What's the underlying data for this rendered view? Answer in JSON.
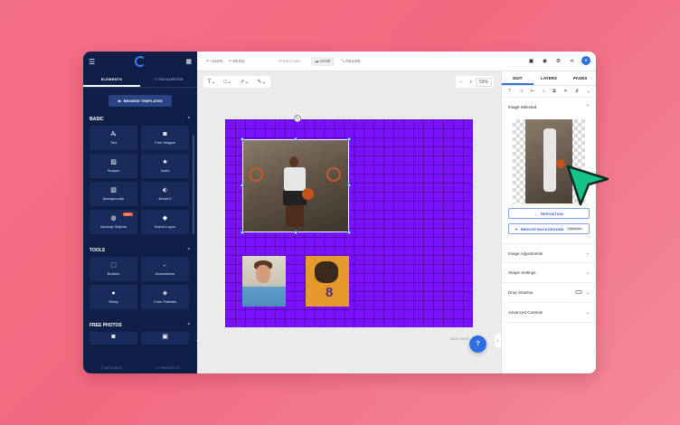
{
  "sidebar": {
    "tabs": [
      {
        "label": "ELEMENTS"
      },
      {
        "label": "FAVOURITES"
      }
    ],
    "browse_button": "BROWSE TEMPLATES",
    "basic_title": "BASIC",
    "basic_items": [
      {
        "label": "Text",
        "icon": "text-icon"
      },
      {
        "label": "Free Images",
        "icon": "camera-icon"
      },
      {
        "label": "Shapes",
        "icon": "image-icon"
      },
      {
        "label": "Icons",
        "icon": "star-icon"
      },
      {
        "label": "Backgrounds",
        "icon": "pattern-icon"
      },
      {
        "label": "Brand It",
        "icon": "tag-icon"
      },
      {
        "label": "Mockup Objects",
        "icon": "mockup-icon",
        "badge": "NEW"
      },
      {
        "label": "Brand Logos",
        "icon": "diamond-icon"
      }
    ],
    "tools_title": "TOOLS",
    "tools_items": [
      {
        "label": "Buttons",
        "icon": "cursor-icon"
      },
      {
        "label": "Annotations",
        "icon": "arrow-icon"
      },
      {
        "label": "Sticky",
        "icon": "chat-icon"
      },
      {
        "label": "Color Palettes",
        "icon": "palette-icon"
      }
    ],
    "free_photos_title": "FREE PHOTOS",
    "bottom": {
      "left": "UPLOADS",
      "right": "PROJECTS"
    }
  },
  "topbar": {
    "undo": "UNDO",
    "redo": "REDO",
    "doc_title": "Front Cover",
    "save": "SAVE",
    "resize": "RESIZE",
    "avatar_initial": "●"
  },
  "canvas": {
    "zoom_value": "59%",
    "new_page": "NEW PAGE",
    "help": "?",
    "page_color": "#7b12ff"
  },
  "right_panel": {
    "tabs": [
      {
        "label": "EDIT"
      },
      {
        "label": "LAYERS"
      },
      {
        "label": "PAGES"
      }
    ],
    "image_selected": "Image Selected",
    "reposition": "REPOSITION",
    "remove_bg": "REMOVE BACKGROUND",
    "pro_badge": "PREMIUM",
    "accordions": [
      {
        "label": "Image Adjustments"
      },
      {
        "label": "Shape Settings"
      },
      {
        "label": "Drop Shadow"
      },
      {
        "label": "Advanced Controls"
      }
    ]
  },
  "colors": {
    "accent": "#2f6fe4",
    "sidebar": "#0f1f47",
    "background": "#f36f86",
    "cursor": "#15c28a"
  }
}
